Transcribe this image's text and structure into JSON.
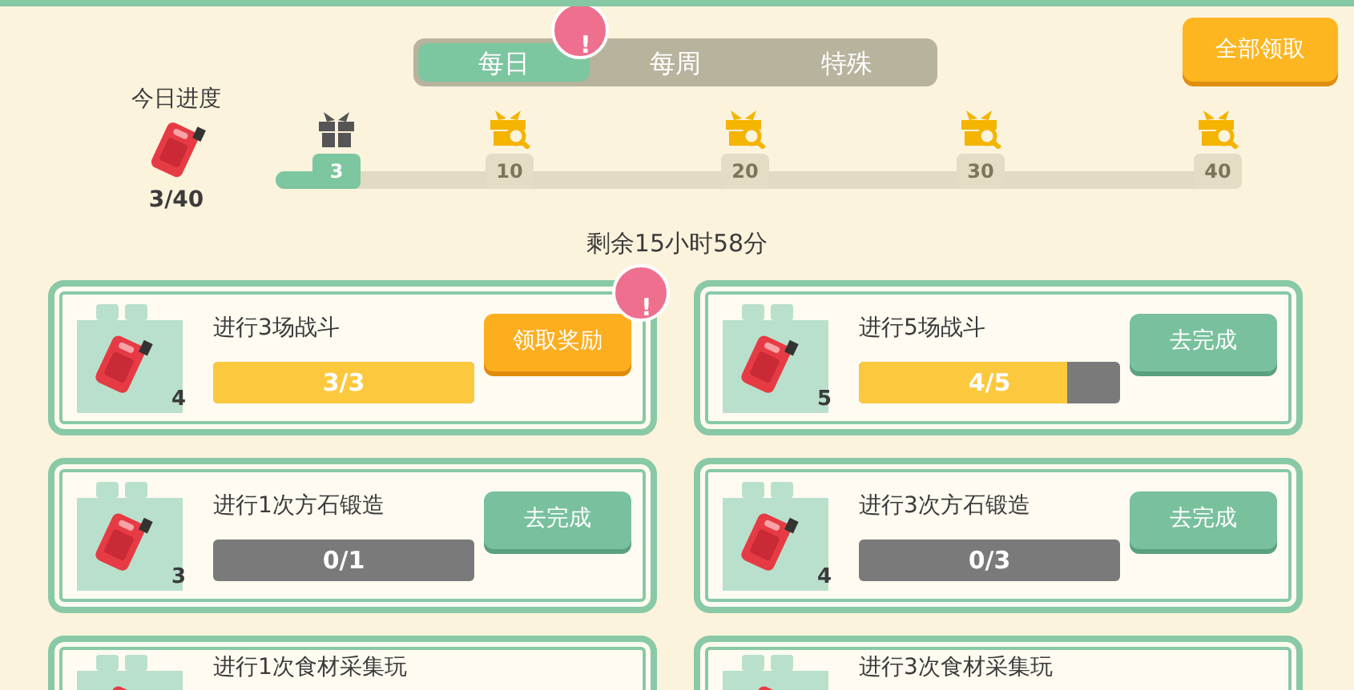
{
  "tabs": [
    {
      "label": "每日",
      "selected": true,
      "badge": "!"
    },
    {
      "label": "每周",
      "selected": false
    },
    {
      "label": "特殊",
      "selected": false
    }
  ],
  "claim_all_button": "全部领取",
  "daily_progress": {
    "label": "今日进度",
    "value": "3/40",
    "level": 0.08,
    "milestones": [
      {
        "label": "3",
        "reached": true
      },
      {
        "label": "10",
        "reached": false
      },
      {
        "label": "20",
        "reached": false
      },
      {
        "label": "30",
        "reached": false
      },
      {
        "label": "40",
        "reached": false
      }
    ]
  },
  "time_remaining": "剩余15小时58分",
  "tasks": [
    {
      "title": "进行3场战斗",
      "reward_count": "4",
      "progress": "3/3",
      "level": 1,
      "button": {
        "label": "领取奖励",
        "kind": "claim"
      },
      "badge": "!"
    },
    {
      "title": "进行5场战斗",
      "reward_count": "5",
      "progress": "4/5",
      "level": 0.8,
      "button": {
        "label": "去完成",
        "kind": "go"
      }
    },
    {
      "title": "进行1次方石锻造",
      "reward_count": "3",
      "progress": "0/1",
      "level": 0,
      "button": {
        "label": "去完成",
        "kind": "go"
      }
    },
    {
      "title": "进行3次方石锻造",
      "reward_count": "4",
      "progress": "0/3",
      "level": 0,
      "button": {
        "label": "去完成",
        "kind": "go"
      }
    },
    {
      "title": "进行1次食材采集玩"
    },
    {
      "title": "进行3次食材采集玩"
    }
  ]
}
